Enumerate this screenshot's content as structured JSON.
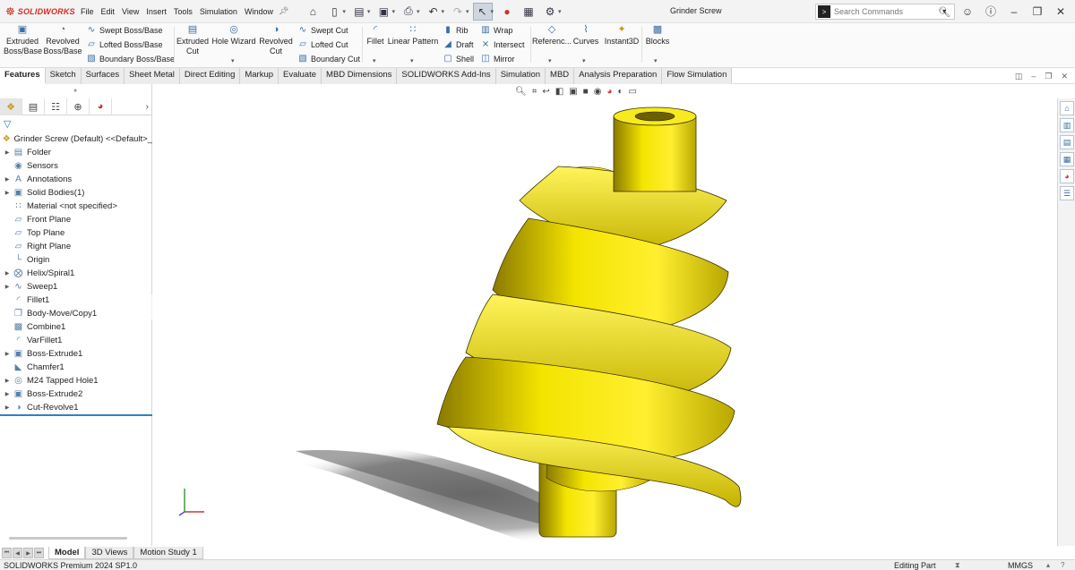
{
  "app": {
    "brand": "SOLIDWORKS",
    "document_title": "Grinder Screw"
  },
  "menu": [
    "File",
    "Edit",
    "View",
    "Insert",
    "Tools",
    "Simulation",
    "Window"
  ],
  "search": {
    "placeholder": "Search Commands"
  },
  "ribbon": {
    "extruded_boss": "Extruded Boss/Base",
    "revolved_boss": "Revolved Boss/Base",
    "swept_boss": "Swept Boss/Base",
    "lofted_boss": "Lofted Boss/Base",
    "boundary_boss": "Boundary Boss/Base",
    "extruded_cut": "Extruded Cut",
    "hole_wizard": "Hole Wizard",
    "revolved_cut": "Revolved Cut",
    "swept_cut": "Swept Cut",
    "lofted_cut": "Lofted Cut",
    "boundary_cut": "Boundary Cut",
    "fillet": "Fillet",
    "linear_pattern": "Linear Pattern",
    "rib": "Rib",
    "draft": "Draft",
    "shell": "Shell",
    "wrap": "Wrap",
    "intersect": "Intersect",
    "mirror": "Mirror",
    "reference": "Referenc...",
    "curves": "Curves",
    "instant3d": "Instant3D",
    "blocks": "Blocks"
  },
  "tabs": [
    "Features",
    "Sketch",
    "Surfaces",
    "Sheet Metal",
    "Direct Editing",
    "Markup",
    "Evaluate",
    "MBD Dimensions",
    "SOLIDWORKS Add-Ins",
    "Simulation",
    "MBD",
    "Analysis Preparation",
    "Flow Simulation"
  ],
  "tree": [
    {
      "label": "Grinder Screw  (Default) <<Default>_",
      "expandable": false,
      "root": true
    },
    {
      "label": "Folder",
      "expandable": true
    },
    {
      "label": "Sensors",
      "expandable": false
    },
    {
      "label": "Annotations",
      "expandable": true
    },
    {
      "label": "Solid Bodies(1)",
      "expandable": true
    },
    {
      "label": "Material <not specified>",
      "expandable": false
    },
    {
      "label": "Front Plane",
      "expandable": false
    },
    {
      "label": "Top Plane",
      "expandable": false
    },
    {
      "label": "Right Plane",
      "expandable": false
    },
    {
      "label": "Origin",
      "expandable": false
    },
    {
      "label": "Helix/Spiral1",
      "expandable": true
    },
    {
      "label": "Sweep1",
      "expandable": true
    },
    {
      "label": "Fillet1",
      "expandable": false
    },
    {
      "label": "Body-Move/Copy1",
      "expandable": false
    },
    {
      "label": "Combine1",
      "expandable": false
    },
    {
      "label": "VarFillet1",
      "expandable": false
    },
    {
      "label": "Boss-Extrude1",
      "expandable": true
    },
    {
      "label": "Chamfer1",
      "expandable": false
    },
    {
      "label": "M24 Tapped Hole1",
      "expandable": true
    },
    {
      "label": "Boss-Extrude2",
      "expandable": true
    },
    {
      "label": "Cut-Revolve1",
      "expandable": true
    }
  ],
  "bottom_tabs": [
    "Model",
    "3D Views",
    "Motion Study 1"
  ],
  "status": {
    "product": "SOLIDWORKS Premium 2024 SP1.0",
    "mode": "Editing Part",
    "units": "MMGS"
  },
  "colors": {
    "part_yellow": "#e6d400",
    "selection_blue": "#2a83c4",
    "brand_red": "#d52b1e"
  }
}
